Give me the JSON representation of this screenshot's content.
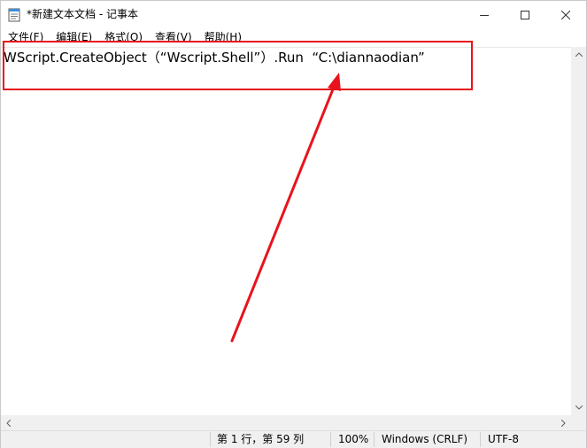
{
  "window": {
    "title": "*新建文本文档 - 记事本"
  },
  "menu": {
    "items": [
      {
        "label": "文件(F)"
      },
      {
        "label": "编辑(E)"
      },
      {
        "label": "格式(O)"
      },
      {
        "label": "查看(V)"
      },
      {
        "label": "帮助(H)"
      }
    ]
  },
  "editor": {
    "content": "WScript.CreateObject（“Wscript.Shell”）.Run  “C:\\diannaodian”"
  },
  "status": {
    "position": "第 1 行，第 59 列",
    "zoom": "100%",
    "line_ending": "Windows (CRLF)",
    "encoding": "UTF-8"
  },
  "annotation": {
    "color": "#e8131c"
  },
  "icons": {
    "app": "notepad-icon",
    "minimize": "minimize-icon",
    "maximize": "maximize-icon",
    "close": "close-icon"
  }
}
